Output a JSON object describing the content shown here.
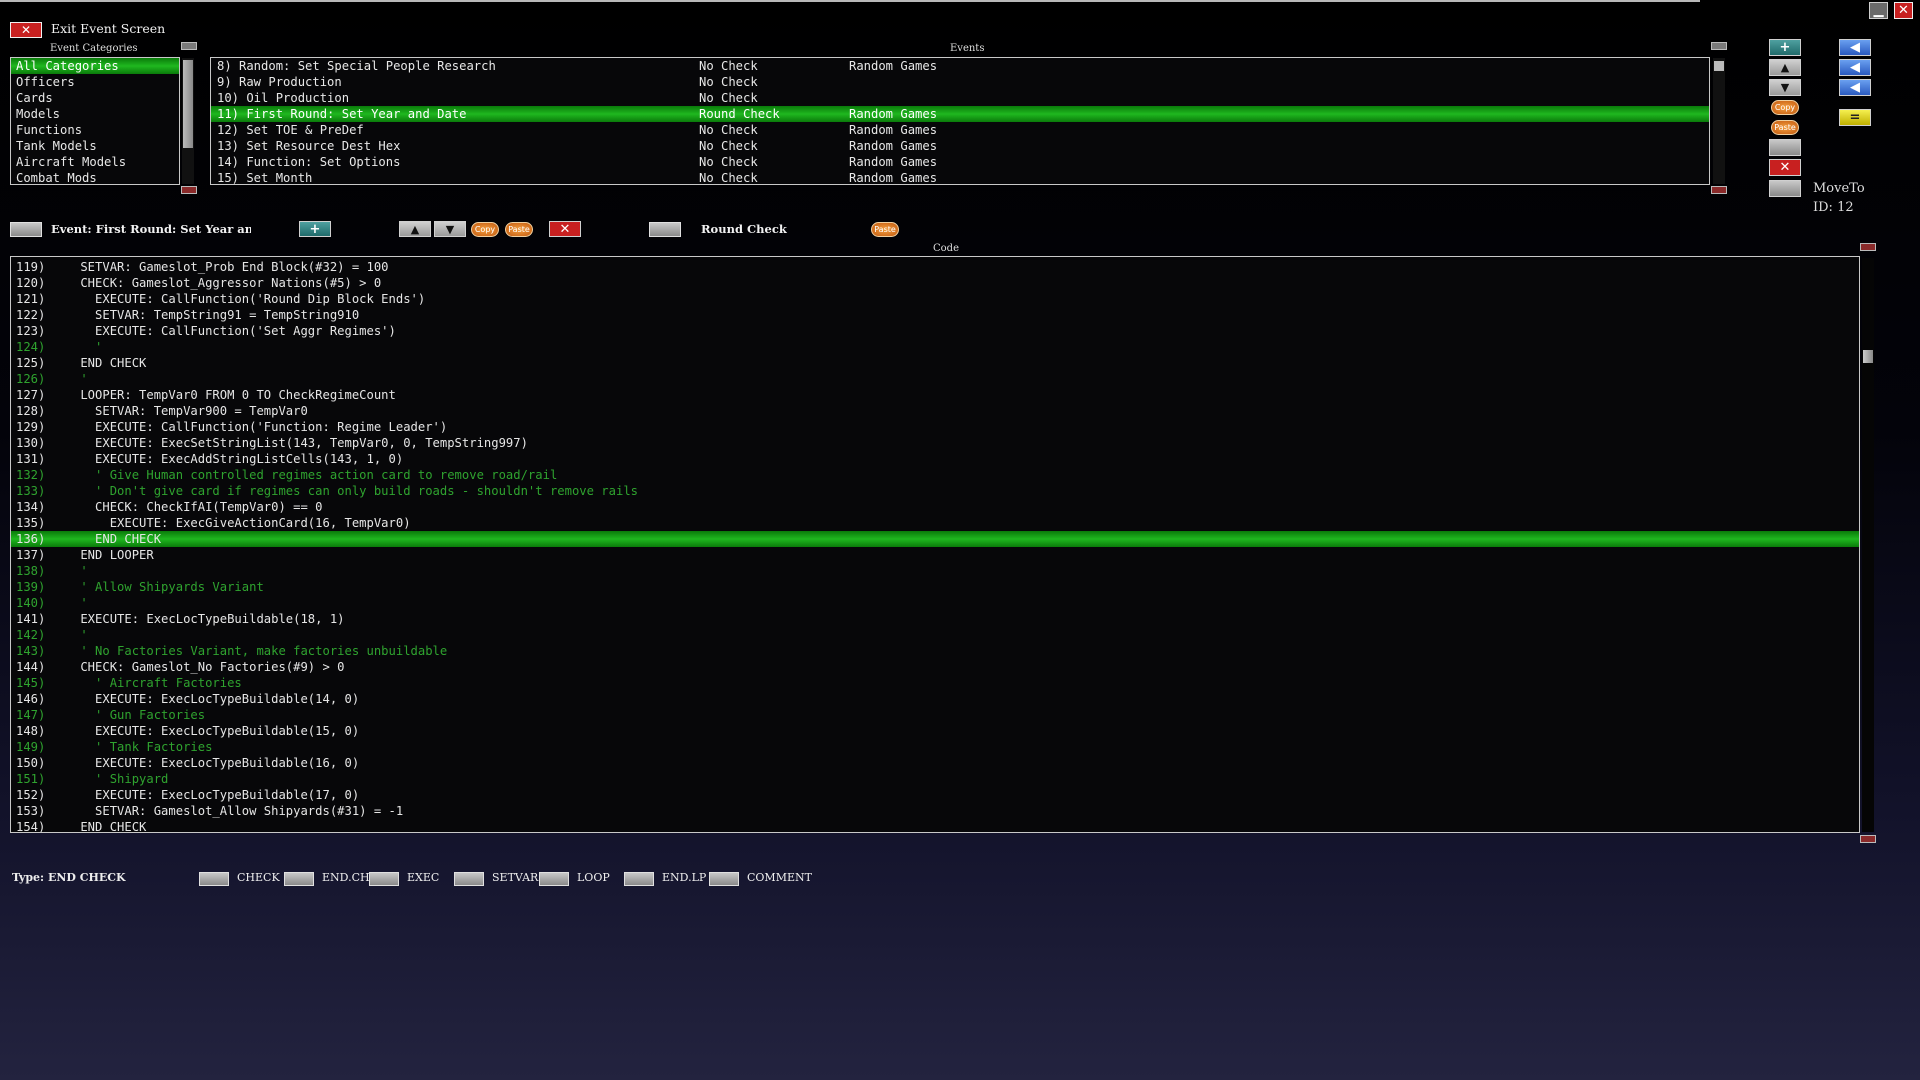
{
  "window": {
    "minimize": "▁",
    "close": "✕"
  },
  "header": {
    "exit_label": "Exit Event Screen"
  },
  "categories": {
    "title": "Event Categories",
    "items": [
      "All Categories",
      "Officers",
      "Cards",
      "Models",
      "Functions",
      "Tank Models",
      "Aircraft Models",
      "Combat Mods"
    ],
    "selected_index": 0
  },
  "events": {
    "title": "Events",
    "rows": [
      {
        "name": "8) Random: Set Special People Research",
        "check": "No Check",
        "category": "Random Games"
      },
      {
        "name": "9) Raw Production",
        "check": "No Check",
        "category": ""
      },
      {
        "name": "10) Oil Production",
        "check": "No Check",
        "category": ""
      },
      {
        "name": "11) First Round: Set Year and Date",
        "check": "Round Check",
        "category": "Random Games"
      },
      {
        "name": "12) Set TOE & PreDef",
        "check": "No Check",
        "category": "Random Games"
      },
      {
        "name": "13) Set Resource Dest Hex",
        "check": "No Check",
        "category": "Random Games"
      },
      {
        "name": "14) Function: Set Options",
        "check": "No Check",
        "category": "Random Games"
      },
      {
        "name": "15) Set Month",
        "check": "No Check",
        "category": "Random Games"
      }
    ],
    "selected_index": 3
  },
  "side": {
    "move_to": "MoveTo",
    "id_label": "ID:  12",
    "copy": "Copy",
    "paste": "Paste"
  },
  "event_bar": {
    "event_label": "Event: First Round: Set Year and Da",
    "check_label": "Round Check",
    "paste": "Paste"
  },
  "code": {
    "title": "Code",
    "selected_index": 17,
    "lines": [
      {
        "n": "119)",
        "t": "    SETVAR: Gameslot_Prob End Block(#32) = 100",
        "c": false
      },
      {
        "n": "120)",
        "t": "    CHECK: Gameslot_Aggressor Nations(#5) > 0",
        "c": false
      },
      {
        "n": "121)",
        "t": "      EXECUTE: CallFunction('Round Dip Block Ends')",
        "c": false
      },
      {
        "n": "122)",
        "t": "      SETVAR: TempString91 = TempString910",
        "c": false
      },
      {
        "n": "123)",
        "t": "      EXECUTE: CallFunction('Set Aggr Regimes')",
        "c": false
      },
      {
        "n": "124)",
        "t": "      '",
        "c": true
      },
      {
        "n": "125)",
        "t": "    END CHECK",
        "c": false
      },
      {
        "n": "126)",
        "t": "    '",
        "c": true
      },
      {
        "n": "127)",
        "t": "    LOOPER: TempVar0 FROM 0 TO CheckRegimeCount",
        "c": false
      },
      {
        "n": "128)",
        "t": "      SETVAR: TempVar900 = TempVar0",
        "c": false
      },
      {
        "n": "129)",
        "t": "      EXECUTE: CallFunction('Function: Regime Leader')",
        "c": false
      },
      {
        "n": "130)",
        "t": "      EXECUTE: ExecSetStringList(143, TempVar0, 0, TempString997)",
        "c": false
      },
      {
        "n": "131)",
        "t": "      EXECUTE: ExecAddStringListCells(143, 1, 0)",
        "c": false
      },
      {
        "n": "132)",
        "t": "      ' Give Human controlled regimes action card to remove road/rail",
        "c": true
      },
      {
        "n": "133)",
        "t": "      ' Don't give card if regimes can only build roads - shouldn't remove rails",
        "c": true
      },
      {
        "n": "134)",
        "t": "      CHECK: CheckIfAI(TempVar0) == 0",
        "c": false
      },
      {
        "n": "135)",
        "t": "        EXECUTE: ExecGiveActionCard(16, TempVar0)",
        "c": false
      },
      {
        "n": "136)",
        "t": "      END CHECK",
        "c": false
      },
      {
        "n": "137)",
        "t": "    END LOOPER",
        "c": false
      },
      {
        "n": "138)",
        "t": "    '",
        "c": true
      },
      {
        "n": "139)",
        "t": "    ' Allow Shipyards Variant",
        "c": true
      },
      {
        "n": "140)",
        "t": "    '",
        "c": true
      },
      {
        "n": "141)",
        "t": "    EXECUTE: ExecLocTypeBuildable(18, 1)",
        "c": false
      },
      {
        "n": "142)",
        "t": "    '",
        "c": true
      },
      {
        "n": "143)",
        "t": "    ' No Factories Variant, make factories unbuildable",
        "c": true
      },
      {
        "n": "144)",
        "t": "    CHECK: Gameslot_No Factories(#9) > 0",
        "c": false
      },
      {
        "n": "145)",
        "t": "      ' Aircraft Factories",
        "c": true
      },
      {
        "n": "146)",
        "t": "      EXECUTE: ExecLocTypeBuildable(14, 0)",
        "c": false
      },
      {
        "n": "147)",
        "t": "      ' Gun Factories",
        "c": true
      },
      {
        "n": "148)",
        "t": "      EXECUTE: ExecLocTypeBuildable(15, 0)",
        "c": false
      },
      {
        "n": "149)",
        "t": "      ' Tank Factories",
        "c": true
      },
      {
        "n": "150)",
        "t": "      EXECUTE: ExecLocTypeBuildable(16, 0)",
        "c": false
      },
      {
        "n": "151)",
        "t": "      ' Shipyard",
        "c": true
      },
      {
        "n": "152)",
        "t": "      EXECUTE: ExecLocTypeBuildable(17, 0)",
        "c": false
      },
      {
        "n": "153)",
        "t": "      SETVAR: Gameslot_Allow Shipyards(#31) = -1",
        "c": false
      },
      {
        "n": "154)",
        "t": "    END CHECK",
        "c": false
      }
    ]
  },
  "type_bar": {
    "type_label": "Type: END CHECK",
    "buttons": [
      "CHECK",
      "END.CH",
      "EXEC",
      "SETVAR",
      "LOOP",
      "END.LP",
      "COMMENT"
    ]
  }
}
